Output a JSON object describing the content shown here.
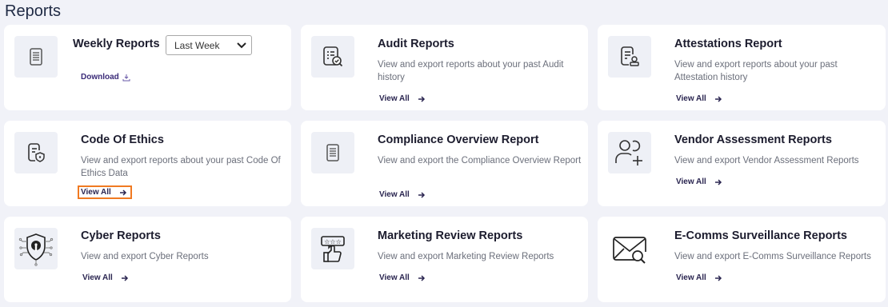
{
  "page": {
    "title": "Reports"
  },
  "cards": {
    "weekly": {
      "title": "Weekly Reports",
      "select_value": "Last Week",
      "download_label": "Download",
      "icon": "document-icon"
    },
    "audit": {
      "title": "Audit Reports",
      "description": "View and export reports about your past Audit history",
      "link": "View All",
      "icon": "audit-checklist-icon"
    },
    "attestations": {
      "title": "Attestations Report",
      "description": "View and export reports about your past Attestation history",
      "link": "View All",
      "icon": "attestation-icon"
    },
    "ethics": {
      "title": "Code Of Ethics",
      "description": "View and export reports about your past Code Of Ethics Data",
      "link": "View All",
      "icon": "ethics-shield-document-icon"
    },
    "compliance": {
      "title": "Compliance Overview Report",
      "description": "View and export the Compliance Overview Report",
      "link": "View All",
      "icon": "document-icon"
    },
    "vendor": {
      "title": "Vendor Assessment Reports",
      "description": "View and export Vendor Assessment Reports",
      "link": "View All",
      "icon": "add-user-icon"
    },
    "cyber": {
      "title": "Cyber Reports",
      "description": "View and export Cyber Reports",
      "link": "View All",
      "icon": "cyber-shield-lock-icon"
    },
    "marketing": {
      "title": "Marketing Review Reports",
      "description": "View and export Marketing Review Reports",
      "link": "View All",
      "icon": "review-thumbs-up-icon"
    },
    "ecomms": {
      "title": "E-Comms Surveillance Reports",
      "description": "View and export E-Comms Surveillance Reports",
      "link": "View All",
      "icon": "mail-search-icon"
    }
  },
  "colors": {
    "background": "#f1f2f8",
    "card": "#ffffff",
    "icon_box": "#eef0f6",
    "link": "#2a2550",
    "focus_outline": "#f07a22"
  }
}
